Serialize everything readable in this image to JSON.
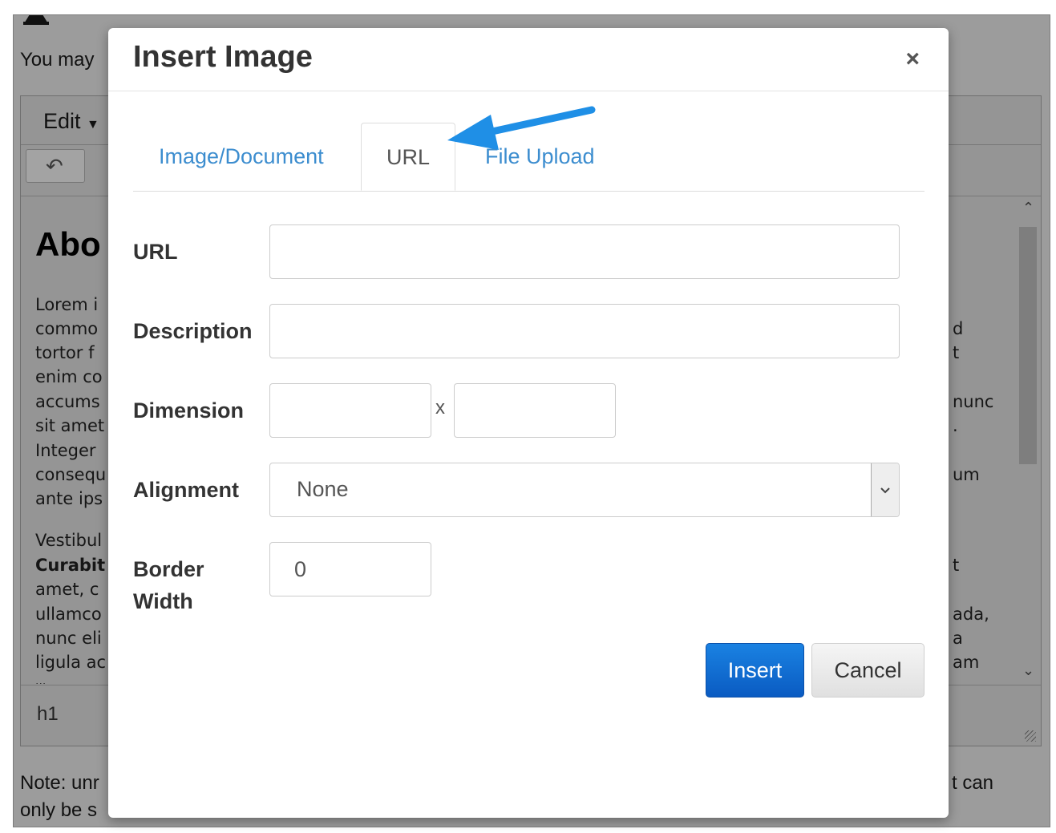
{
  "background": {
    "intro_text": "You may",
    "menu_edit": "Edit",
    "heading": "Abo",
    "paragraph1": [
      "Lorem i",
      "commo",
      "tortor f",
      "enim co",
      "accums",
      "sit amet",
      "Integer",
      "consequ",
      "ante ips"
    ],
    "right_fragments": [
      "d",
      "t",
      "nunc",
      ".",
      "um",
      "t",
      "ada,",
      "a",
      "am"
    ],
    "paragraph2": [
      "Vestibul",
      "Curabit",
      "amet, c",
      "ullamco",
      "nunc eli",
      "ligula ac",
      "..."
    ],
    "status_path": "h1",
    "note_line1_left": "Note: unr",
    "note_line1_right": "t can",
    "note_line2_left": "only be s"
  },
  "modal": {
    "title": "Insert Image",
    "close_glyph": "×",
    "tabs": [
      {
        "label": "Image/Document",
        "active": false
      },
      {
        "label": "URL",
        "active": true
      },
      {
        "label": "File Upload",
        "active": false
      }
    ],
    "fields": {
      "url_label": "URL",
      "url_value": "",
      "description_label": "Description",
      "description_value": "",
      "dimension_label": "Dimension",
      "width_value": "",
      "dimension_separator": "x",
      "height_value": "",
      "alignment_label": "Alignment",
      "alignment_value": "None",
      "border_label_line1": "Border",
      "border_label_line2": "Width",
      "border_value": "0"
    },
    "buttons": {
      "insert": "Insert",
      "cancel": "Cancel"
    }
  },
  "colors": {
    "link": "#3c8dcf",
    "primary": "#0a6ad4",
    "annotation_arrow": "#1f8fe6"
  },
  "icons": [
    "warning-icon",
    "undo-icon",
    "close-icon",
    "chevron-down-icon",
    "scroll-up-icon",
    "scroll-down-icon",
    "resize-grip-icon",
    "annotation-arrow"
  ]
}
